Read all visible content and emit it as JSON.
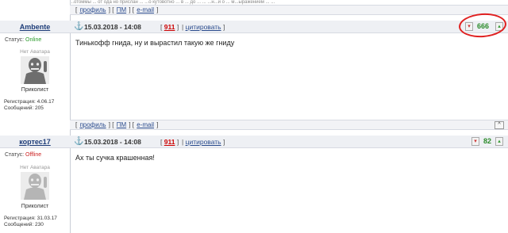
{
  "top_strip": "...отоммы ... от ода но прислан ... ...о кутовотно ... в ... до ... ... ...н...и о ... м...ыражением ... ...",
  "links": {
    "profile": "профиль",
    "pm": "ПМ",
    "email": "e-mail"
  },
  "top_button": "^",
  "posts": [
    {
      "username": "Ambente",
      "status_label": "Статус:",
      "status": "Online",
      "no_avatar": "Нет Аватара",
      "rank": "Приколист",
      "reg_label": "Регистрация:",
      "reg_date": "4.06.17",
      "msgs_label": "Сообщений:",
      "msgs": "205",
      "date": "15.03.2018 - 14:08",
      "post_num": "911",
      "quote": "цитировать",
      "rating": "666",
      "text": "Тинькофф гнида, ну и вырастил такую же гниду"
    },
    {
      "username": "кортес17",
      "status_label": "Статус:",
      "status": "Offline",
      "no_avatar": "Нет Аватара",
      "rank": "Приколист",
      "reg_label": "Регистрация:",
      "reg_date": "31.03.17",
      "msgs_label": "Сообщений:",
      "msgs": "230",
      "date": "15.03.2018 - 14:08",
      "post_num": "911",
      "quote": "цитировать",
      "rating": "82",
      "text": "Ах ты сучка крашенная!"
    }
  ],
  "colors": {
    "online": "#2a9a2a",
    "offline": "#cc2222",
    "rating": "#2a8a2a",
    "annotation": "#e02020"
  },
  "icons": [
    "anchor-icon",
    "thumb-down-icon",
    "thumb-up-icon",
    "arrow-up-icon"
  ]
}
